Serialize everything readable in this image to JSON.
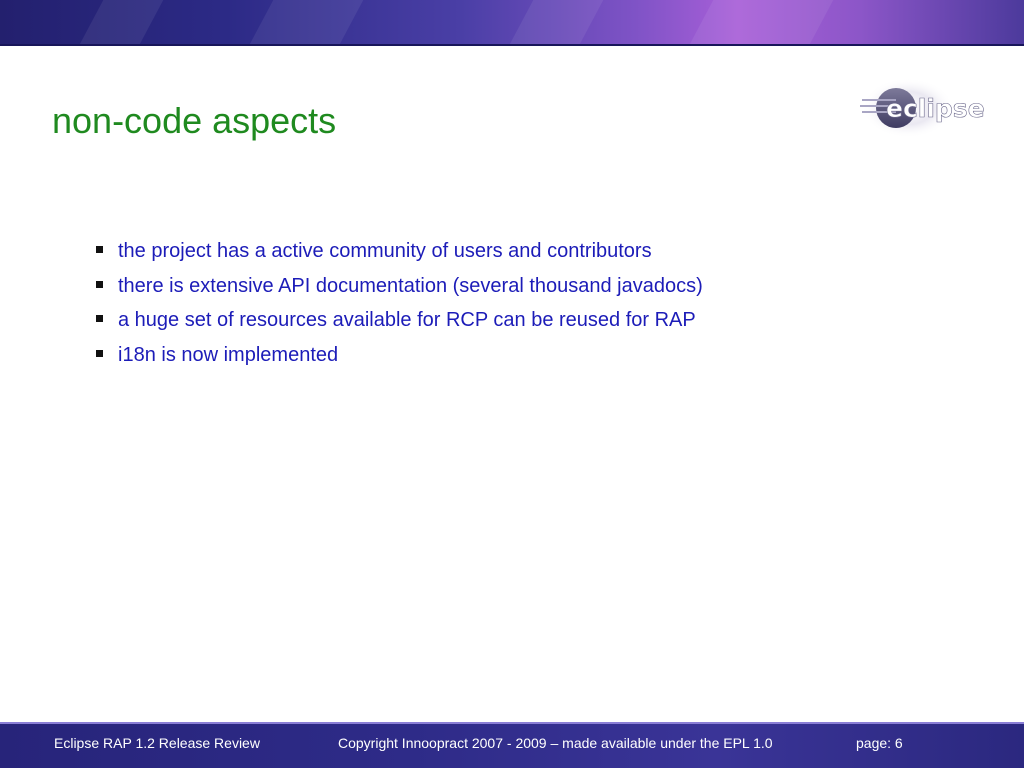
{
  "slide": {
    "title": "non-code aspects",
    "bullets": [
      "the project has a active community of users and contributors",
      "there is extensive API documentation (several thousand javadocs)",
      "a huge set of resources available for RCP can be reused for RAP",
      "i18n is now implemented"
    ]
  },
  "logo": {
    "text": "eclipse"
  },
  "footer": {
    "left": "Eclipse RAP 1.2 Release Review",
    "center": "Copyright Innoopract 2007 - 2009  – made available under the EPL 1.0",
    "page": "page: 6"
  },
  "colors": {
    "title": "#1f8a1f",
    "bullet_text": "#1c1cb8",
    "banner_dark": "#2c2a86",
    "banner_light": "#a85fd8",
    "footer_bg": "#2e2b88"
  }
}
